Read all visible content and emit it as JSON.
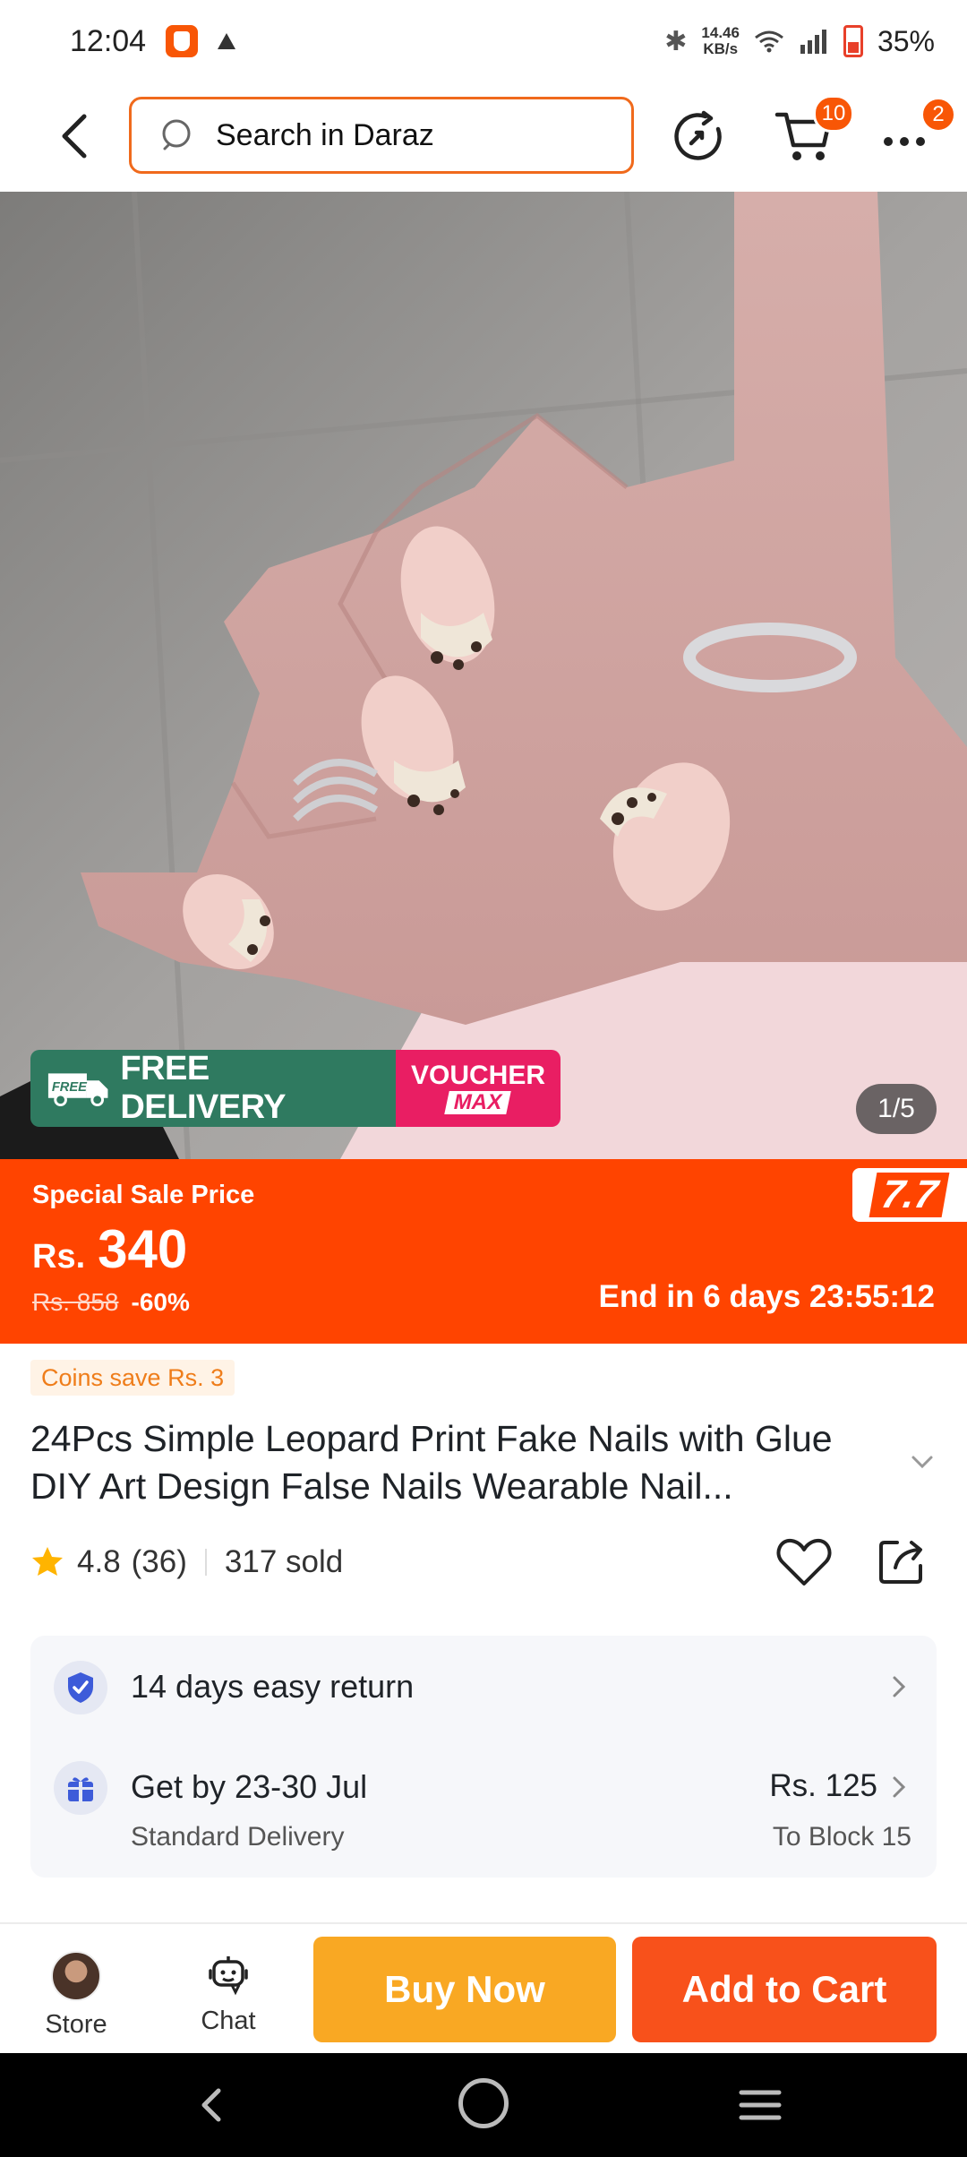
{
  "status_bar": {
    "time": "12:04",
    "net_speed_value": "14.46",
    "net_speed_unit": "KB/s",
    "battery": "35%"
  },
  "header": {
    "search_placeholder": "Search in Daraz",
    "cart_count": "10",
    "more_badge": "2"
  },
  "gallery": {
    "counter": "1/5",
    "free_delivery_label": "FREE DELIVERY",
    "free_tag": "FREE",
    "voucher_top": "VOUCHER",
    "voucher_bottom": "MAX"
  },
  "price": {
    "label": "Special Sale Price",
    "currency": "Rs.",
    "value": "340",
    "original": "Rs. 858",
    "discount": "-60%",
    "campaign": "7.7",
    "countdown": "End in 6 days 23:55:12"
  },
  "product": {
    "coins": "Coins save Rs. 3",
    "title": "24Pcs Simple Leopard Print Fake Nails with Glue DIY Art Design False Nails Wearable Nail...",
    "rating": "4.8",
    "reviews": "(36)",
    "sold": "317 sold"
  },
  "services": {
    "return_label": "14 days easy return",
    "delivery_date": "Get by 23-30 Jul",
    "delivery_type": "Standard Delivery",
    "delivery_fee": "Rs. 125",
    "delivery_dest": "To Block 15"
  },
  "actions": {
    "store": "Store",
    "chat": "Chat",
    "buy_now": "Buy Now",
    "add_to_cart": "Add to Cart"
  },
  "colors": {
    "brand": "#f85606",
    "price_bg": "#ff4400",
    "buy_now": "#f9a823",
    "free_delivery": "#2f7a60",
    "voucher": "#e91e63"
  }
}
